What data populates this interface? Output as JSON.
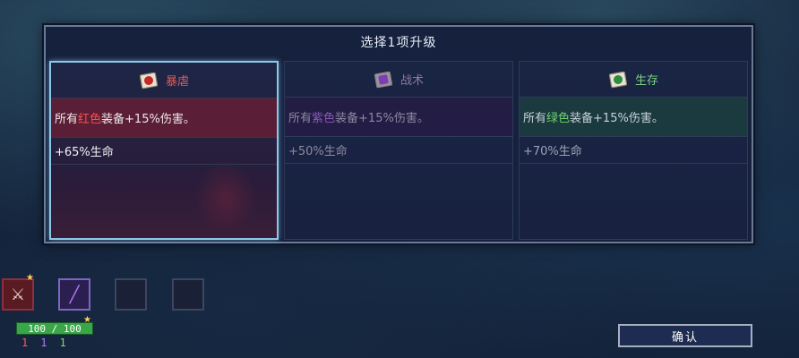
{
  "modal": {
    "title": "选择1项升级"
  },
  "cards": [
    {
      "title": "暴虐",
      "icon": "red-scroll-icon",
      "main_prefix": "所有",
      "main_color_word": "红色",
      "main_suffix": "装备+15%伤害。",
      "sub": "+65%生命",
      "selected": true
    },
    {
      "title": "战术",
      "icon": "purple-scroll-icon",
      "main_prefix": "所有",
      "main_color_word": "紫色",
      "main_suffix": "装备+15%伤害。",
      "sub": "+50%生命",
      "selected": false
    },
    {
      "title": "生存",
      "icon": "green-scroll-icon",
      "main_prefix": "所有",
      "main_color_word": "绿色",
      "main_suffix": "装备+15%伤害。",
      "sub": "+70%生命",
      "selected": false
    }
  ],
  "inventory": {
    "slots": [
      "weapon-icon",
      "bow-icon",
      "empty",
      "empty"
    ],
    "hp": "100 / 100",
    "stats": {
      "red": "1",
      "purple": "1",
      "green": "1"
    }
  },
  "confirm_label": "确认",
  "colors": {
    "red_accent": "#e25a55",
    "purple_accent": "#8a5ab8",
    "green_accent": "#7dd186",
    "selection_border": "#8cc8e8"
  }
}
